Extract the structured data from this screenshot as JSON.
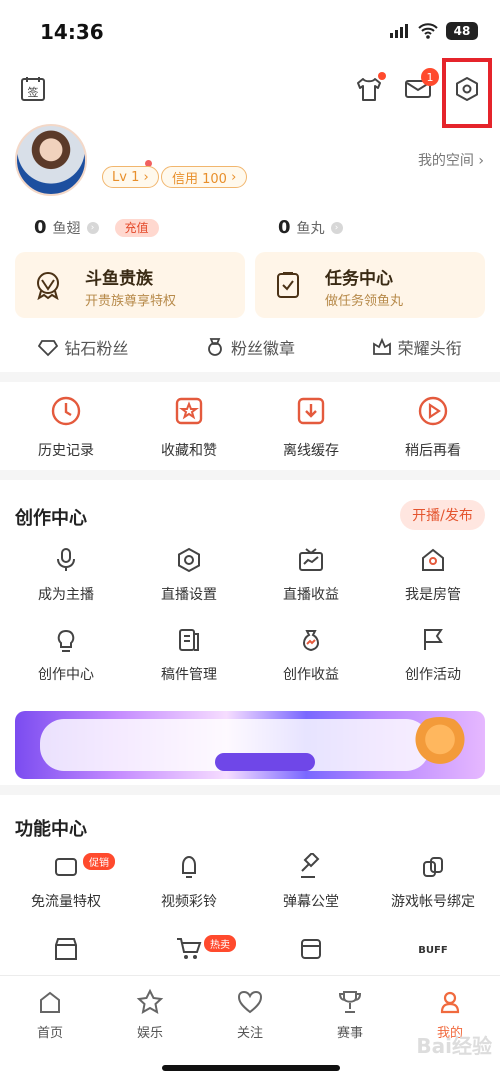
{
  "status_bar": {
    "time": "14:36",
    "battery": "48"
  },
  "header": {
    "mail_badge": "1",
    "level": "Lv 1",
    "credit": "信用 100",
    "my_space": "我的空间"
  },
  "stats": {
    "left_value": "0",
    "left_unit": "鱼翅",
    "recharge": "充值",
    "right_value": "0",
    "right_unit": "鱼丸"
  },
  "promos": [
    {
      "title": "斗鱼贵族",
      "subtitle": "开贵族尊享特权"
    },
    {
      "title": "任务中心",
      "subtitle": "做任务领鱼丸"
    }
  ],
  "fan_links": [
    {
      "label": "钻石粉丝"
    },
    {
      "label": "粉丝徽章"
    },
    {
      "label": "荣耀头衔"
    }
  ],
  "quick_actions": [
    {
      "label": "历史记录"
    },
    {
      "label": "收藏和赞"
    },
    {
      "label": "离线缓存"
    },
    {
      "label": "稍后再看"
    }
  ],
  "creator_center": {
    "title": "创作中心",
    "publish": "开播/发布",
    "items": [
      {
        "label": "成为主播"
      },
      {
        "label": "直播设置"
      },
      {
        "label": "直播收益"
      },
      {
        "label": "我是房管"
      },
      {
        "label": "创作中心"
      },
      {
        "label": "稿件管理"
      },
      {
        "label": "创作收益"
      },
      {
        "label": "创作活动"
      }
    ]
  },
  "function_center": {
    "title": "功能中心",
    "items": [
      {
        "label": "免流量特权",
        "badge": "促销"
      },
      {
        "label": "视频彩铃",
        "badge": ""
      },
      {
        "label": "弹幕公堂",
        "badge": ""
      },
      {
        "label": "游戏帐号绑定",
        "badge": ""
      }
    ],
    "partial_badge": "热卖"
  },
  "bottom_nav": [
    {
      "label": "首页"
    },
    {
      "label": "娱乐"
    },
    {
      "label": "关注"
    },
    {
      "label": "赛事"
    },
    {
      "label": "我的"
    }
  ],
  "watermark": "Bai经验"
}
